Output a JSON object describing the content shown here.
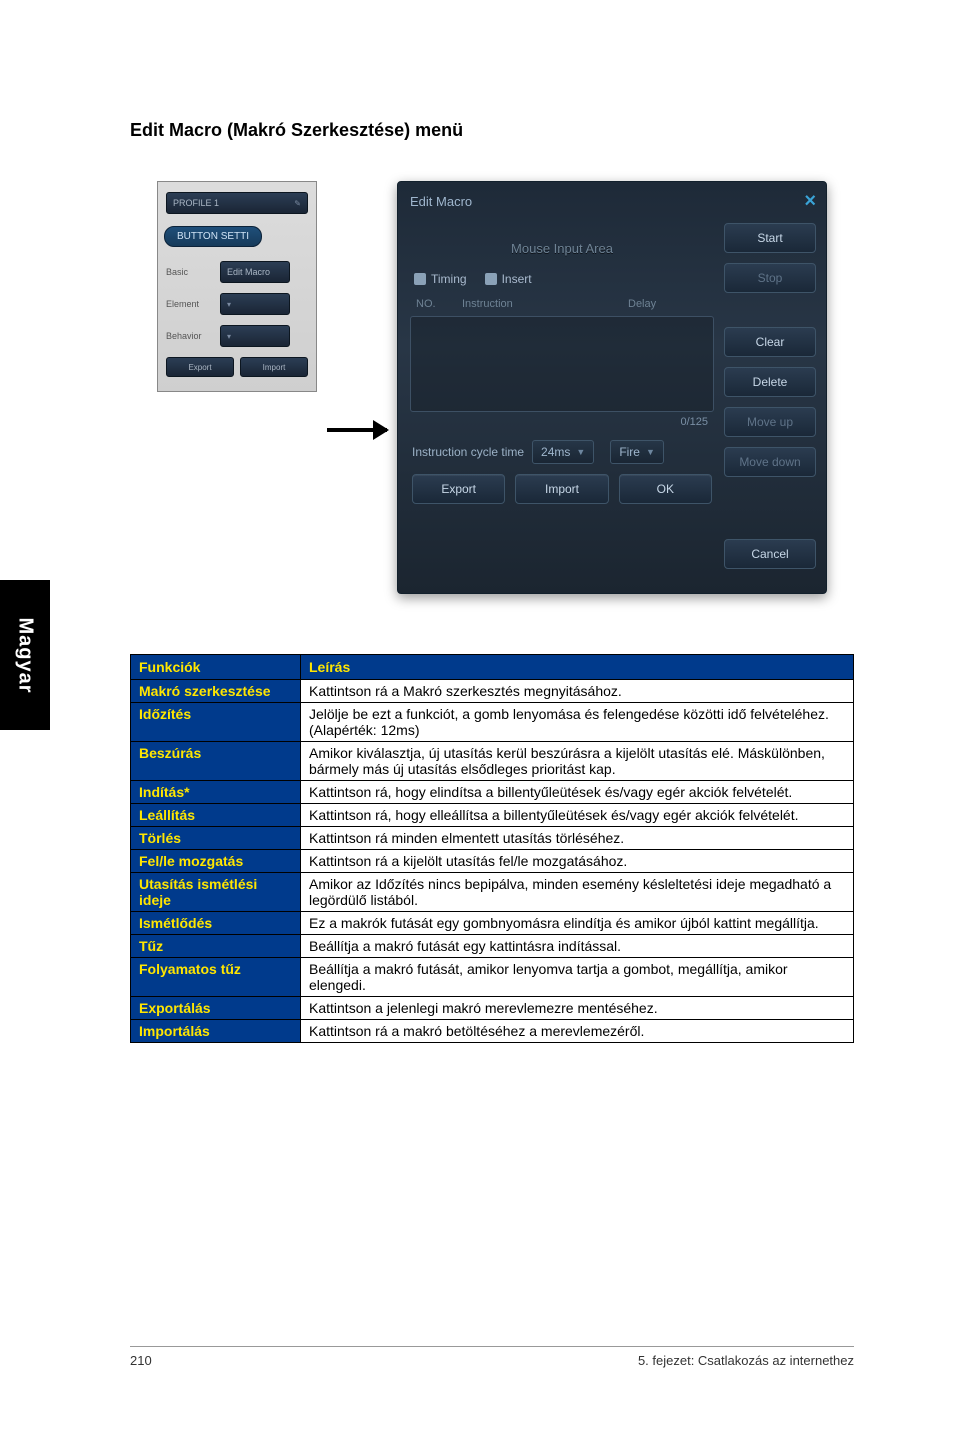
{
  "page": {
    "title": "Edit Macro (Makró Szerkesztése) menü",
    "side_tab": "Magyar",
    "footer_left": "210",
    "footer_right": "5. fejezet: Csatlakozás az internethez"
  },
  "left_panel": {
    "profile": "PROFILE 1",
    "tab": "BUTTON SETTI",
    "rows": [
      {
        "label": "Basic",
        "value": "Edit Macro"
      },
      {
        "label": "Element",
        "value": ""
      },
      {
        "label": "Behavior",
        "value": ""
      }
    ],
    "bottom_left": "Export",
    "bottom_right": "Import",
    "edit_icon": "✎"
  },
  "dialog": {
    "title": "Edit Macro",
    "close": "×",
    "mouse_area": "Mouse Input Area",
    "tab_timing": "Timing",
    "tab_insert": "Insert",
    "head_no": "NO.",
    "head_instruction": "Instruction",
    "head_delay": "Delay",
    "counter": "0/125",
    "ict_label": "Instruction cycle time",
    "ict_value": "24ms",
    "fire_label": "Fire",
    "btn_export": "Export",
    "btn_import": "Import",
    "btn_ok": "OK",
    "side": {
      "start": "Start",
      "stop": "Stop",
      "clear": "Clear",
      "delete": "Delete",
      "move_up": "Move up",
      "move_down": "Move down",
      "cancel": "Cancel"
    }
  },
  "table": {
    "head_func": "Funkciók",
    "head_desc": "Leírás",
    "rows": [
      {
        "fn": "Makró szerkesztése",
        "desc": "Kattintson rá a Makró szerkesztés megnyitásához."
      },
      {
        "fn": "Időzítés",
        "desc": "Jelölje be ezt a funkciót, a gomb lenyomása és felengedése közötti idő felvételéhez. (Alapérték: 12ms)"
      },
      {
        "fn": "Beszúrás",
        "desc": "Amikor kiválasztja, új utasítás kerül beszúrásra a kijelölt utasítás elé. Máskülönben, bármely más új utasítás elsődleges prioritást kap."
      },
      {
        "fn": "Indítás*",
        "desc": "Kattintson rá, hogy elindítsa a billentyűleütések és/vagy egér akciók felvételét."
      },
      {
        "fn": "Leállítás",
        "desc": "Kattintson rá, hogy elleállítsa a billentyűleütések és/vagy egér akciók felvételét."
      },
      {
        "fn": "Törlés",
        "desc": "Kattintson rá minden elmentett utasítás törléséhez."
      },
      {
        "fn": "Fel/le mozgatás",
        "desc": "Kattintson rá a kijelölt utasítás fel/le mozgatásához."
      },
      {
        "fn": "Utasítás ismétlési ideje",
        "desc": "Amikor az Időzítés nincs bepipálva, minden esemény késleltetési ideje megadható a legördülő listából."
      },
      {
        "fn": "Ismétlődés",
        "desc": "Ez a makrók futását egy gombnyomásra elindítja és amikor újból kattint megállítja."
      },
      {
        "fn": "Tűz",
        "desc": "Beállítja a makró futását egy kattintásra indítással."
      },
      {
        "fn": "Folyamatos tűz",
        "desc": "Beállítja a makró futását, amikor lenyomva tartja a gombot, megállítja, amikor elengedi."
      },
      {
        "fn": "Exportálás",
        "desc": "Kattintson a jelenlegi makró merevlemezre mentéséhez."
      },
      {
        "fn": "Importálás",
        "desc": "Kattintson rá a makró betöltéséhez a merevlemezéről."
      }
    ]
  }
}
